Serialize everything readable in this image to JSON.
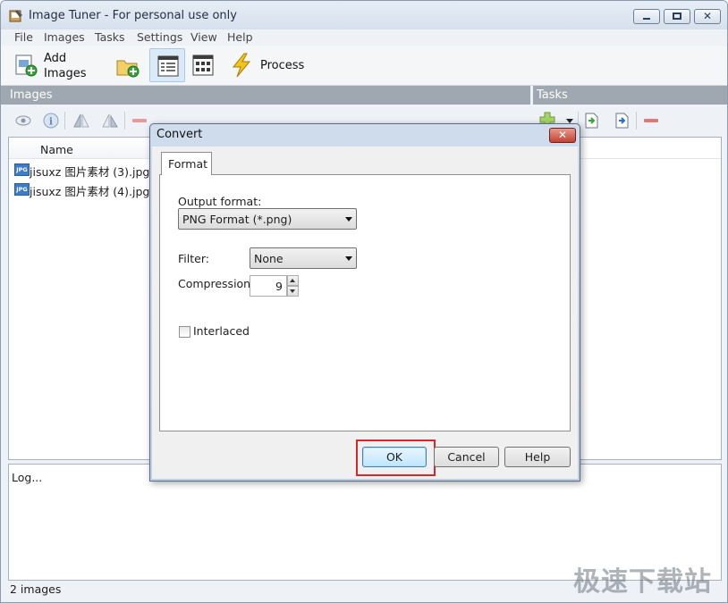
{
  "window": {
    "title": "Image Tuner - For personal use only"
  },
  "menu": [
    "File",
    "Images",
    "Tasks",
    "Settings",
    "View",
    "Help"
  ],
  "toolbar": {
    "add_images_label_1": "Add",
    "add_images_label_2": "Images",
    "process_label": "Process"
  },
  "panels": {
    "images_title": "Images",
    "tasks_title": "Tasks"
  },
  "images_list": {
    "column_name": "Name",
    "files": [
      {
        "type": "JPG",
        "name": "jisuxz 图片素材 (3).jpg"
      },
      {
        "type": "JPG",
        "name": "jisuxz 图片素材 (4).jpg"
      }
    ]
  },
  "log": {
    "text": "Log..."
  },
  "status": {
    "text": "2 images"
  },
  "watermark": "极速下载站",
  "dialog": {
    "title": "Convert",
    "close_glyph": "✕",
    "tab": "Format",
    "output_format_label": "Output format:",
    "output_format_value": "PNG Format (*.png)",
    "filter_label": "Filter:",
    "filter_value": "None",
    "compression_label": "Compression:",
    "compression_value": "9",
    "interlaced_label": "Interlaced",
    "interlaced_checked": false,
    "ok_label": "OK",
    "cancel_label": "Cancel",
    "help_label": "Help"
  },
  "colors": {
    "highlight": "#d52828",
    "panel_header": "#9fa7b0",
    "remove_icon": "#e07878"
  }
}
